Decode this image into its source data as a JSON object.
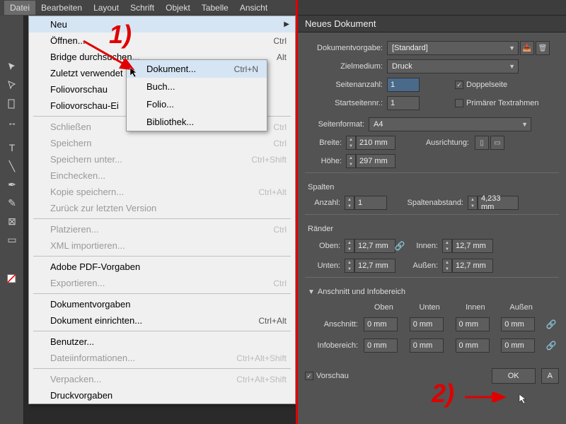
{
  "menubar": {
    "items": [
      "Datei",
      "Bearbeiten",
      "Layout",
      "Schrift",
      "Objekt",
      "Tabelle",
      "Ansicht"
    ]
  },
  "file_menu": {
    "neu": "Neu",
    "oeffnen": "Öffnen...",
    "oeffnen_sc": "Ctrl",
    "bridge": "Bridge durchsuchen...",
    "bridge_sc": "Alt",
    "zuletzt": "Zuletzt verwendet",
    "foliovorschau": "Foliovorschau",
    "foliovorschau_ei": "Foliovorschau-Ei",
    "schliessen": "Schließen",
    "schliessen_sc": "Ctrl",
    "speichern": "Speichern",
    "speichern_sc": "Ctrl",
    "speichern_unter": "Speichern unter...",
    "speichern_unter_sc": "Ctrl+Shift",
    "einchecken": "Einchecken...",
    "kopie": "Kopie speichern...",
    "kopie_sc": "Ctrl+Alt",
    "zurueck": "Zurück zur letzten Version",
    "platzieren": "Platzieren...",
    "platzieren_sc": "Ctrl",
    "xml": "XML importieren...",
    "pdf": "Adobe PDF-Vorgaben",
    "export": "Exportieren...",
    "export_sc": "Ctrl",
    "dokvorgaben": "Dokumentvorgaben",
    "dokeinrichten": "Dokument einrichten...",
    "dokeinrichten_sc": "Ctrl+Alt",
    "benutzer": "Benutzer...",
    "dateiinfo": "Dateiinformationen...",
    "dateiinfo_sc": "Ctrl+Alt+Shift",
    "verpacken": "Verpacken...",
    "verpacken_sc": "Ctrl+Alt+Shift",
    "druckvor": "Druckvorgaben"
  },
  "submenu": {
    "dokument": "Dokument...",
    "dokument_sc": "Ctrl+N",
    "buch": "Buch...",
    "folio": "Folio...",
    "bibliothek": "Bibliothek..."
  },
  "dialog": {
    "title": "Neues Dokument",
    "preset_label": "Dokumentvorgabe:",
    "preset_value": "[Standard]",
    "intent_label": "Zielmedium:",
    "intent_value": "Druck",
    "pages_label": "Seitenanzahl:",
    "pages_value": "1",
    "facing_label": "Doppelseite",
    "start_label": "Startseitennr.:",
    "start_value": "1",
    "primary_label": "Primärer Textrahmen",
    "pagesize_label": "Seitenformat:",
    "pagesize_value": "A4",
    "width_label": "Breite:",
    "width_value": "210 mm",
    "height_label": "Höhe:",
    "height_value": "297 mm",
    "orient_label": "Ausrichtung:",
    "columns_title": "Spalten",
    "colcount_label": "Anzahl:",
    "colcount_value": "1",
    "gutter_label": "Spaltenabstand:",
    "gutter_value": "4,233 mm",
    "margins_title": "Ränder",
    "top_label": "Oben:",
    "top_value": "12,7 mm",
    "bottom_label": "Unten:",
    "bottom_value": "12,7 mm",
    "inside_label": "Innen:",
    "inside_value": "12,7 mm",
    "outside_label": "Außen:",
    "outside_value": "12,7 mm",
    "bleed_title": "Anschnitt und Infobereich",
    "col_top": "Oben",
    "col_bottom": "Unten",
    "col_inside": "Innen",
    "col_outside": "Außen",
    "bleed_label": "Anschnitt:",
    "bleed_value": "0 mm",
    "slug_label": "Infobereich:",
    "slug_value": "0 mm",
    "preview_label": "Vorschau",
    "ok": "OK",
    "abbr": "A"
  },
  "annotations": {
    "one": "1)",
    "two": "2)"
  }
}
